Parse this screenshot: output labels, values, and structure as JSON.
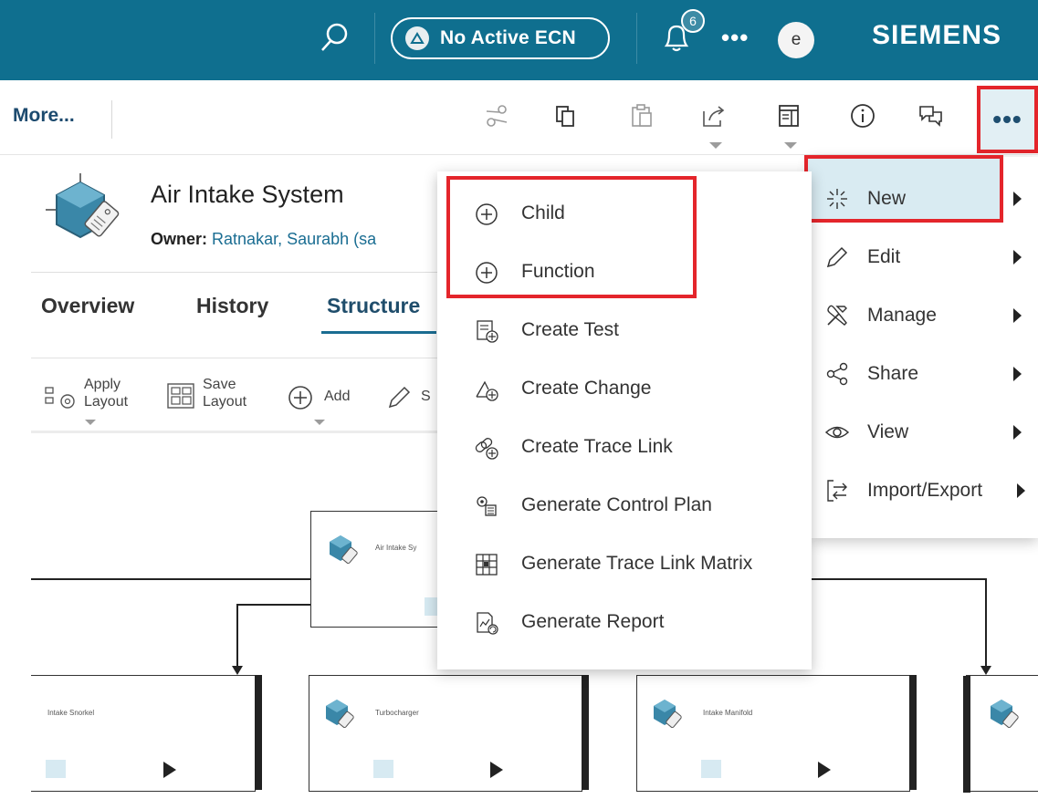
{
  "header": {
    "ecn_label": "No Active ECN",
    "notification_count": "6",
    "more_label": "•••",
    "avatar_initial": "e",
    "brand": "SIEMENS"
  },
  "toolbar": {
    "more_link": "More...",
    "icons": [
      "cut-icon",
      "copy-icon",
      "paste-icon",
      "share-out-icon",
      "layout-icon",
      "info-icon",
      "chat-icon"
    ],
    "overflow_label": "•••"
  },
  "object": {
    "title": "Air Intake System",
    "owner_label": "Owner:",
    "owner_value": "Ratnakar, Saurabh (sa"
  },
  "tabs": [
    {
      "label": "Overview"
    },
    {
      "label": "History"
    },
    {
      "label": "Structure"
    }
  ],
  "subtools": {
    "apply_layout": [
      "Apply",
      "Layout"
    ],
    "save_layout": [
      "Save",
      "Layout"
    ],
    "add": "Add",
    "fourth_partial": "S"
  },
  "diagram": {
    "root_label": "Air Intake Sy",
    "children": [
      "Intake Snorkel",
      "Turbocharger",
      "Intake Manifold"
    ]
  },
  "menu": {
    "items": [
      {
        "label": "New",
        "icon": "sparkle-icon"
      },
      {
        "label": "Edit",
        "icon": "pencil-icon"
      },
      {
        "label": "Manage",
        "icon": "tools-icon"
      },
      {
        "label": "Share",
        "icon": "share-icon"
      },
      {
        "label": "View",
        "icon": "eye-icon"
      },
      {
        "label": "Import/Export",
        "icon": "import-export-icon"
      }
    ]
  },
  "submenu": {
    "items": [
      {
        "label": "Child",
        "icon": "add-circle-icon"
      },
      {
        "label": "Function",
        "icon": "add-circle-icon"
      },
      {
        "label": "Create Test",
        "icon": "test-icon"
      },
      {
        "label": "Create Change",
        "icon": "change-icon"
      },
      {
        "label": "Create Trace Link",
        "icon": "trace-link-icon"
      },
      {
        "label": "Generate Control Plan",
        "icon": "control-plan-icon"
      },
      {
        "label": "Generate Trace Link Matrix",
        "icon": "matrix-icon"
      },
      {
        "label": "Generate Report",
        "icon": "report-icon"
      }
    ]
  },
  "colors": {
    "header_bg": "#0f6f8f",
    "accent": "#1a6d92",
    "highlight_border": "#e4252b",
    "menu_hover": "#d9ebf2"
  }
}
